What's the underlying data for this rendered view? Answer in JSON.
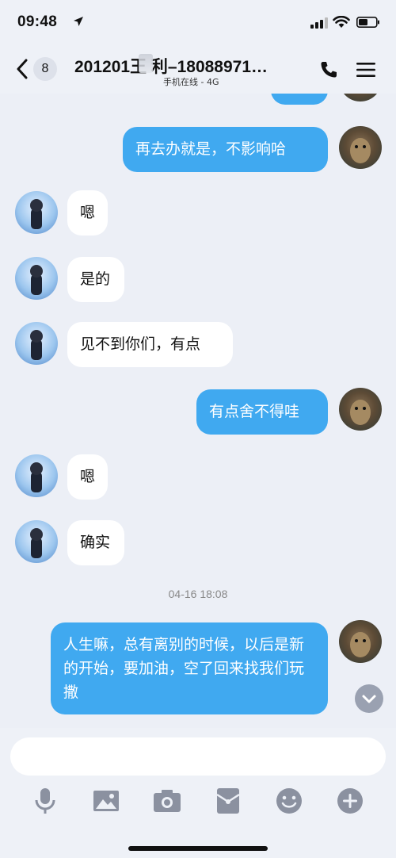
{
  "status_bar": {
    "time": "09:48"
  },
  "nav": {
    "unread_count": "8",
    "title": "201201王 利–18088971…",
    "subtitle": "手机在线 - 4G"
  },
  "messages": [
    {
      "side": "out",
      "text": "再去办就是，不影响哈"
    },
    {
      "side": "in",
      "text": "嗯"
    },
    {
      "side": "in",
      "text": "是的"
    },
    {
      "side": "in",
      "text": "见不到你们，有点"
    },
    {
      "side": "out",
      "text": "有点舍不得哇"
    },
    {
      "side": "in",
      "text": "嗯"
    },
    {
      "side": "in",
      "text": "确实"
    },
    {
      "side": "out",
      "text": "人生嘛，总有离别的时候，以后是新的开始，要加油，空了回来找我们玩撒"
    }
  ],
  "time_divider": "04-16 18:08",
  "input": {
    "placeholder": ""
  },
  "toolbar": [
    "microphone-icon",
    "image-icon",
    "camera-icon",
    "red-packet-icon",
    "emoji-icon",
    "plus-icon"
  ],
  "colors": {
    "out_bubble": "#40a9f0",
    "in_bubble": "#ffffff",
    "background": "#eceff6"
  }
}
